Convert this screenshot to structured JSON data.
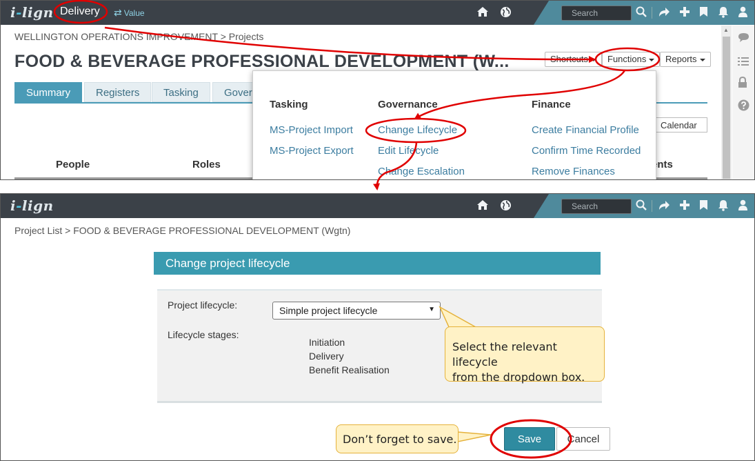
{
  "topbar": {
    "logo_pre": "i",
    "logo_dot": "-",
    "logo_post": "lign",
    "app_name": "Delivery",
    "switch_label": "Value",
    "search_placeholder": "Search",
    "icons": [
      "home-icon",
      "globe-icon",
      "search-icon",
      "share-icon",
      "plus-icon",
      "bookmark-icon",
      "bell-icon",
      "user-icon"
    ]
  },
  "top": {
    "breadcrumb": "WELLINGTON OPERATIONS IMPROVEMENT > Projects",
    "title": "FOOD & BEVERAGE PROFESSIONAL DEVELOPMENT (W...",
    "shortcuts": "Shortcuts",
    "functions": "Functions",
    "reports": "Reports",
    "tabs": [
      "Summary",
      "Registers",
      "Tasking",
      "Govern"
    ],
    "calendar": "Calendar",
    "columns": [
      "People",
      "Roles",
      "ents"
    ]
  },
  "menu": {
    "tasking": {
      "heading": "Tasking",
      "items": [
        "MS-Project Import",
        "MS-Project Export"
      ]
    },
    "governance": {
      "heading": "Governance",
      "items": [
        "Change Lifecycle",
        "Edit Lifecycle",
        "Change Escalation"
      ]
    },
    "finance": {
      "heading": "Finance",
      "items": [
        "Create Financial Profile",
        "Confirm Time Recorded",
        "Remove Finances"
      ]
    }
  },
  "bottom": {
    "breadcrumb": "Project List > FOOD & BEVERAGE PROFESSIONAL DEVELOPMENT (Wgtn)",
    "dialog_title": "Change project lifecycle",
    "lifecycle_label": "Project lifecycle:",
    "lifecycle_value": "Simple project lifecycle",
    "stages_label": "Lifecycle stages:",
    "stages": [
      "Initiation",
      "Delivery",
      "Benefit Realisation"
    ],
    "save": "Save",
    "cancel": "Cancel"
  },
  "callouts": {
    "dropdown_tip_line1": "Select the relevant lifecycle",
    "dropdown_tip_line2": "from the dropdown box.",
    "save_tip": "Don’t forget to save."
  },
  "colors": {
    "topbar": "#3b4148",
    "accent": "#4a9bb7",
    "dialog_header": "#3a9bb0",
    "annotation": "#e00000",
    "callout_fill": "#fff2c6"
  }
}
